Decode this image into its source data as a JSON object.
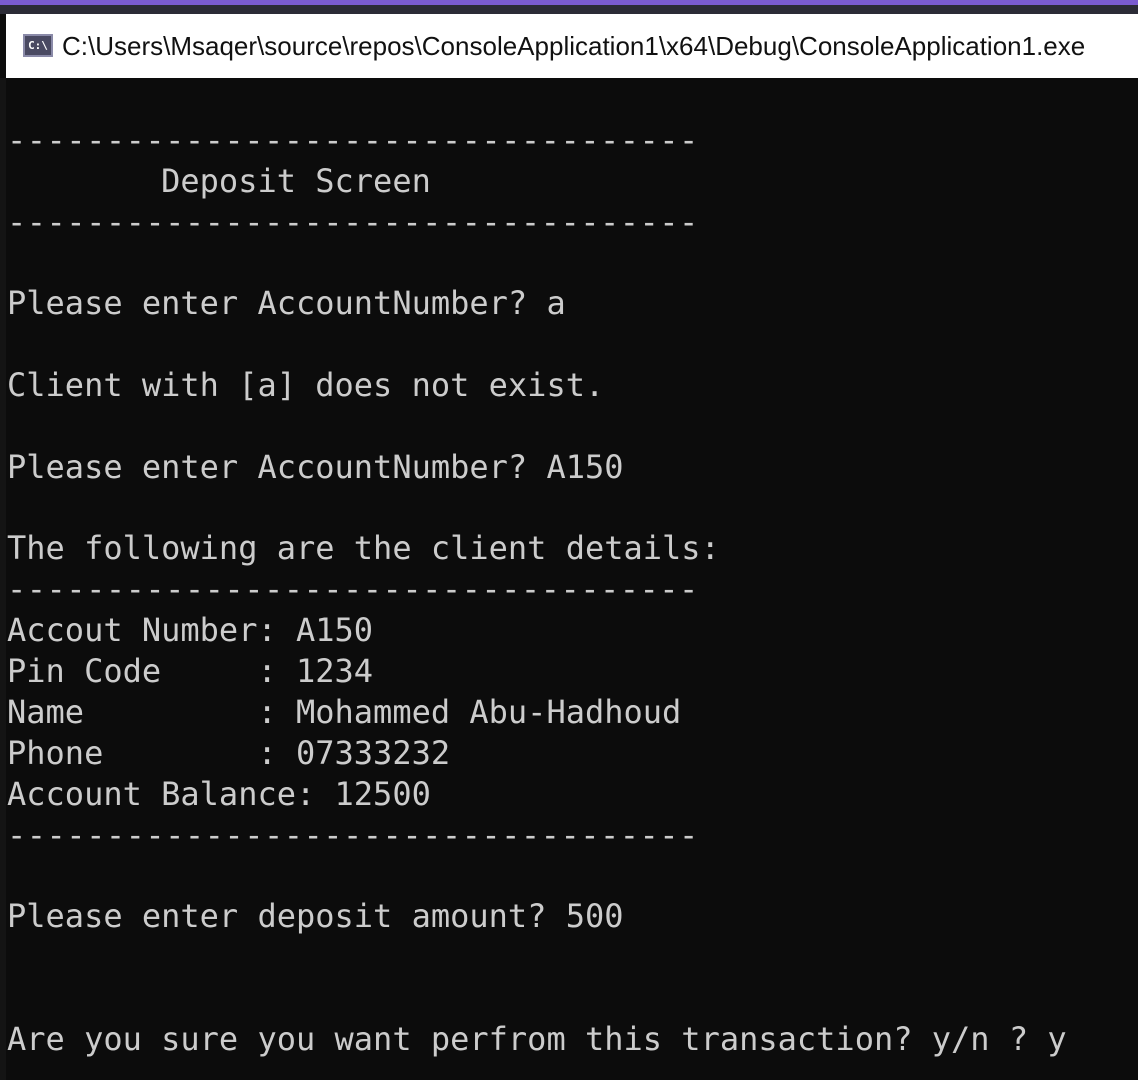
{
  "window": {
    "title": "C:\\Users\\Msaqer\\source\\repos\\ConsoleApplication1\\x64\\Debug\\ConsoleApplication1.exe",
    "icon": "cmd-icon",
    "icon_text": "C:\\"
  },
  "console": {
    "divider": "-----------------------------------",
    "screen_title": "        Deposit Screen",
    "prompt_account_1": "Please enter AccountNumber? a",
    "not_exist": "Client with [a] does not exist.",
    "prompt_account_2": "Please enter AccountNumber? A150",
    "details_heading": "The following are the client details:",
    "account_number": "Accout Number: A150",
    "pin_code": "Pin Code     : 1234",
    "name": "Name         : Mohammed Abu-Hadhoud",
    "phone": "Phone        : 07333232",
    "balance": "Account Balance: 12500",
    "deposit_prompt": "Please enter deposit amount? 500",
    "confirm_prompt": "Are you sure you want perfrom this transaction? y/n ? y"
  },
  "colors": {
    "background": "#0c0c0c",
    "text": "#cccccc",
    "accent": "#7a5bd0"
  }
}
